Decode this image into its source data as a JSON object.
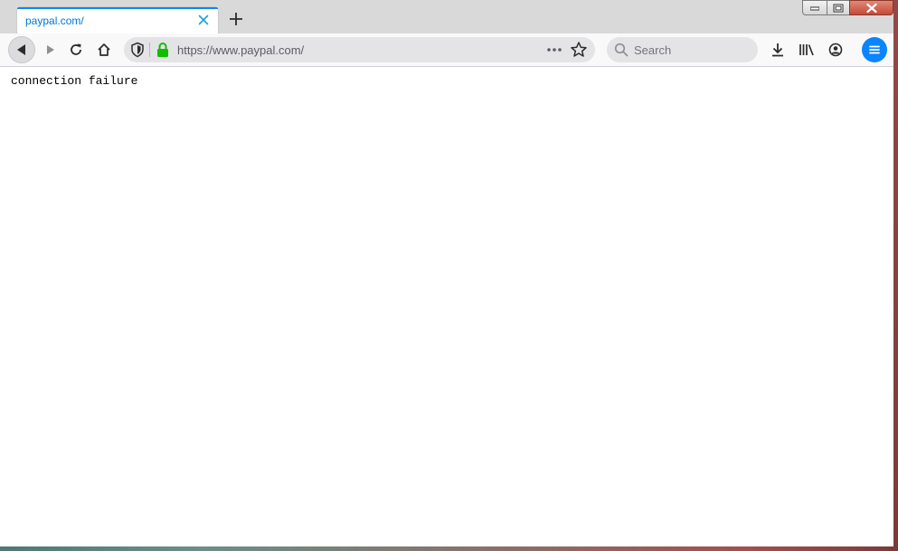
{
  "tab": {
    "title": "paypal.com/"
  },
  "address_bar": {
    "url": "https://www.paypal.com/"
  },
  "search": {
    "placeholder": "Search"
  },
  "page": {
    "message": "connection failure"
  },
  "icons": {
    "tab_close": "close-icon",
    "new_tab": "plus-icon",
    "back": "back-arrow-icon",
    "forward": "forward-arrow-icon",
    "reload": "reload-icon",
    "home": "home-icon",
    "tracking": "shield-icon",
    "secure": "lock-icon",
    "page_actions": "more-dots-icon",
    "bookmark": "star-icon",
    "downloads": "download-icon",
    "library": "library-icon",
    "account": "account-icon",
    "menu": "hamburger-menu-icon"
  },
  "colors": {
    "accent": "#0a84ff",
    "tab_title": "#0078d4",
    "secure_lock": "#12bc00"
  }
}
